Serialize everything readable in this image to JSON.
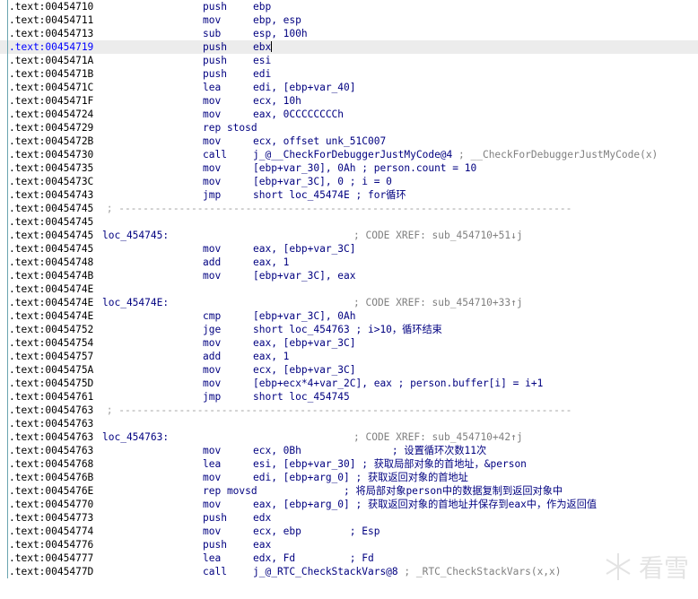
{
  "lines": [
    {
      "addr": ".text:00454710",
      "mn": "push",
      "ops": "ebp"
    },
    {
      "addr": ".text:00454711",
      "mn": "mov",
      "ops": "ebp, esp"
    },
    {
      "addr": ".text:00454713",
      "mn": "sub",
      "ops": "esp, 100h"
    },
    {
      "addr": ".text:00454719",
      "mn": "push",
      "ops": "ebx",
      "hl": true
    },
    {
      "addr": ".text:0045471A",
      "mn": "push",
      "ops": "esi"
    },
    {
      "addr": ".text:0045471B",
      "mn": "push",
      "ops": "edi"
    },
    {
      "addr": ".text:0045471C",
      "mn": "lea",
      "ops": "edi, [ebp+var_40]"
    },
    {
      "addr": ".text:0045471F",
      "mn": "mov",
      "ops": "ecx, 10h"
    },
    {
      "addr": ".text:00454724",
      "mn": "mov",
      "ops": "eax, 0CCCCCCCCh"
    },
    {
      "addr": ".text:00454729",
      "mn": "rep stosd",
      "ops": ""
    },
    {
      "addr": ".text:0045472B",
      "mn": "mov",
      "ops": "ecx, offset unk_51C007"
    },
    {
      "addr": ".text:00454730",
      "mn": "call",
      "ops": "j_@__CheckForDebuggerJustMyCode@4",
      "tail": " ; __CheckForDebuggerJustMyCode(x)"
    },
    {
      "addr": ".text:00454735",
      "mn": "mov",
      "ops": "[ebp+var_30], 0Ah ; person.count = 10"
    },
    {
      "addr": ".text:0045473C",
      "mn": "mov",
      "ops": "[ebp+var_3C], 0 ; i = 0"
    },
    {
      "addr": ".text:00454743",
      "mn": "jmp",
      "ops": "short loc_45474E ; for循环"
    },
    {
      "addr": ".text:00454745",
      "sep": " ; ---------------------------------------------------------------------------"
    },
    {
      "addr": ".text:00454745"
    },
    {
      "addr": ".text:00454745",
      "label": "loc_454745:",
      "xref": "; CODE XREF: sub_454710+51↓j"
    },
    {
      "addr": ".text:00454745",
      "mn": "mov",
      "ops": "eax, [ebp+var_3C]"
    },
    {
      "addr": ".text:00454748",
      "mn": "add",
      "ops": "eax, 1"
    },
    {
      "addr": ".text:0045474B",
      "mn": "mov",
      "ops": "[ebp+var_3C], eax"
    },
    {
      "addr": ".text:0045474E"
    },
    {
      "addr": ".text:0045474E",
      "label": "loc_45474E:",
      "xref": "; CODE XREF: sub_454710+33↑j"
    },
    {
      "addr": ".text:0045474E",
      "mn": "cmp",
      "ops": "[ebp+var_3C], 0Ah"
    },
    {
      "addr": ".text:00454752",
      "mn": "jge",
      "ops": "short loc_454763 ; i>10，循环结束"
    },
    {
      "addr": ".text:00454754",
      "mn": "mov",
      "ops": "eax, [ebp+var_3C]"
    },
    {
      "addr": ".text:00454757",
      "mn": "add",
      "ops": "eax, 1"
    },
    {
      "addr": ".text:0045475A",
      "mn": "mov",
      "ops": "ecx, [ebp+var_3C]"
    },
    {
      "addr": ".text:0045475D",
      "mn": "mov",
      "ops": "[ebp+ecx*4+var_2C], eax ; person.buffer[i] = i+1"
    },
    {
      "addr": ".text:00454761",
      "mn": "jmp",
      "ops": "short loc_454745"
    },
    {
      "addr": ".text:00454763",
      "sep": " ; ---------------------------------------------------------------------------"
    },
    {
      "addr": ".text:00454763"
    },
    {
      "addr": ".text:00454763",
      "label": "loc_454763:",
      "xref": "; CODE XREF: sub_454710+42↑j"
    },
    {
      "addr": ".text:00454763",
      "mn": "mov",
      "ops": "ecx, 0Bh               ; 设置循环次数11次"
    },
    {
      "addr": ".text:00454768",
      "mn": "lea",
      "ops": "esi, [ebp+var_30] ; 获取局部对象的首地址，&person"
    },
    {
      "addr": ".text:0045476B",
      "mn": "mov",
      "ops": "edi, [ebp+arg_0] ; 获取返回对象的首地址"
    },
    {
      "addr": ".text:0045476E",
      "mn": "rep movsd",
      "ops": "               ; 将局部对象person中的数据复制到返回对象中"
    },
    {
      "addr": ".text:00454770",
      "mn": "mov",
      "ops": "eax, [ebp+arg_0] ; 获取返回对象的首地址并保存到eax中，作为返回值"
    },
    {
      "addr": ".text:00454773",
      "mn": "push",
      "ops": "edx"
    },
    {
      "addr": ".text:00454774",
      "mn": "mov",
      "ops": "ecx, ebp        ; Esp"
    },
    {
      "addr": ".text:00454776",
      "mn": "push",
      "ops": "eax"
    },
    {
      "addr": ".text:00454777",
      "mn": "lea",
      "ops": "edx, Fd         ; Fd"
    },
    {
      "addr": ".text:0045477D",
      "mn": "call",
      "ops": "j_@_RTC_CheckStackVars@8",
      "tail": " ; _RTC_CheckStackVars(x,x)"
    }
  ],
  "watermark": "看雪",
  "watermark_icon": "snowflake-icon"
}
